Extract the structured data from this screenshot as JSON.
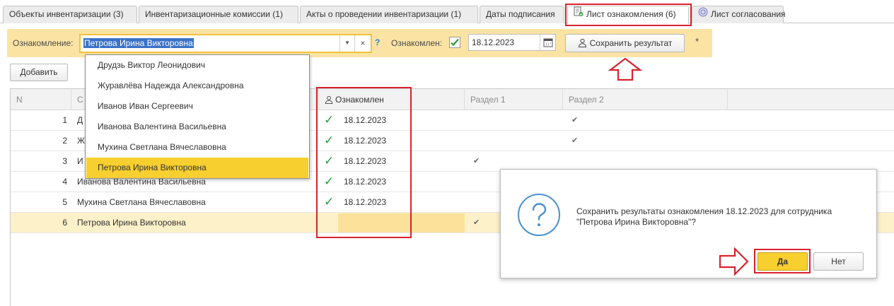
{
  "tabs": [
    {
      "label": "Объекты инвентаризации (3)"
    },
    {
      "label": "Инвентаризационные комиссии (1)"
    },
    {
      "label": "Акты о проведении инвентаризации (1)"
    },
    {
      "label": "Даты подписания"
    },
    {
      "label": "Лист ознакомления (6)",
      "icon": "document-check-icon",
      "active": true
    },
    {
      "label": "Лист согласования",
      "icon": "approval-circle-icon"
    }
  ],
  "form": {
    "acq_label": "Ознакомление:",
    "acq_value": "Петрова Ирина Викторовна",
    "help": "?",
    "acquainted_label": "Ознакомлен:",
    "acquainted_checked": true,
    "date_value": "18.12.2023",
    "save_button": "Сохранить результат",
    "modified_mark": "*",
    "add_button": "Добавить"
  },
  "dropdown": {
    "items": [
      "Друдзь Виктор Леонидович",
      "Журавлёва Надежда Александровна",
      "Иванов Иван Сергеевич",
      "Иванова Валентина Васильевна",
      "Мухина Светлана Вячеславовна",
      "Петрова Ирина Викторовна"
    ],
    "selected": "Петрова Ирина Викторовна"
  },
  "table": {
    "columns": {
      "n": "N",
      "employee": "С",
      "acquainted": "Ознакомлен",
      "section1": "Раздел 1",
      "section2": "Раздел 2"
    },
    "rows": [
      {
        "n": "1",
        "employee": "Д",
        "acq_checked": true,
        "acq_date": "18.12.2023",
        "s1": false,
        "s2": true
      },
      {
        "n": "2",
        "employee": "Ж",
        "acq_checked": true,
        "acq_date": "18.12.2023",
        "s1": false,
        "s2": true
      },
      {
        "n": "3",
        "employee": "И",
        "acq_checked": true,
        "acq_date": "18.12.2023",
        "s1": true,
        "s2": false
      },
      {
        "n": "4",
        "employee": "Иванова Валентина Васильевна",
        "acq_checked": true,
        "acq_date": "18.12.2023",
        "s1": false,
        "s2": false
      },
      {
        "n": "5",
        "employee": "Мухина Светлана Вячеславовна",
        "acq_checked": true,
        "acq_date": "18.12.2023",
        "s1": false,
        "s2": false
      },
      {
        "n": "6",
        "employee": "Петрова Ирина Викторовна",
        "acq_checked": false,
        "acq_date": "",
        "s1": true,
        "s2": false,
        "selected": true
      }
    ]
  },
  "dialog": {
    "line1": "Сохранить результаты ознакомления 18.12.2023 для сотрудника",
    "line2": "\"Петрова Ирина Викторовна\"?",
    "yes": "Да",
    "no": "Нет",
    "icon": "question-icon"
  },
  "colors": {
    "accent_yellow": "#f7cf2e",
    "highlight_red": "#d9232d",
    "check_green": "#2e9b3a",
    "band_bg": "#fbe3a4"
  }
}
